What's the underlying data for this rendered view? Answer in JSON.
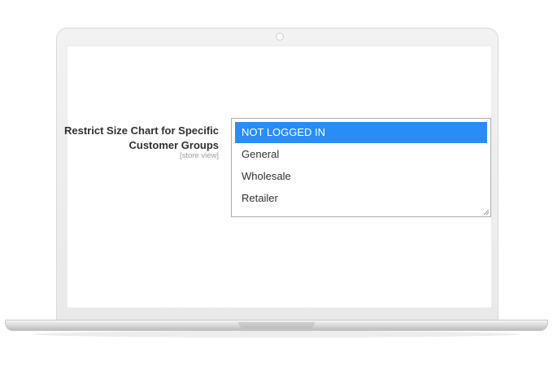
{
  "field": {
    "label_line1": "Restrict Size Chart for Specific",
    "label_line2": "Customer Groups",
    "scope": "[store view]"
  },
  "customer_groups": {
    "options": [
      {
        "label": "NOT LOGGED IN",
        "selected": true
      },
      {
        "label": "General",
        "selected": false
      },
      {
        "label": "Wholesale",
        "selected": false
      },
      {
        "label": "Retailer",
        "selected": false
      }
    ],
    "selected_color": "#2a8cf5"
  }
}
